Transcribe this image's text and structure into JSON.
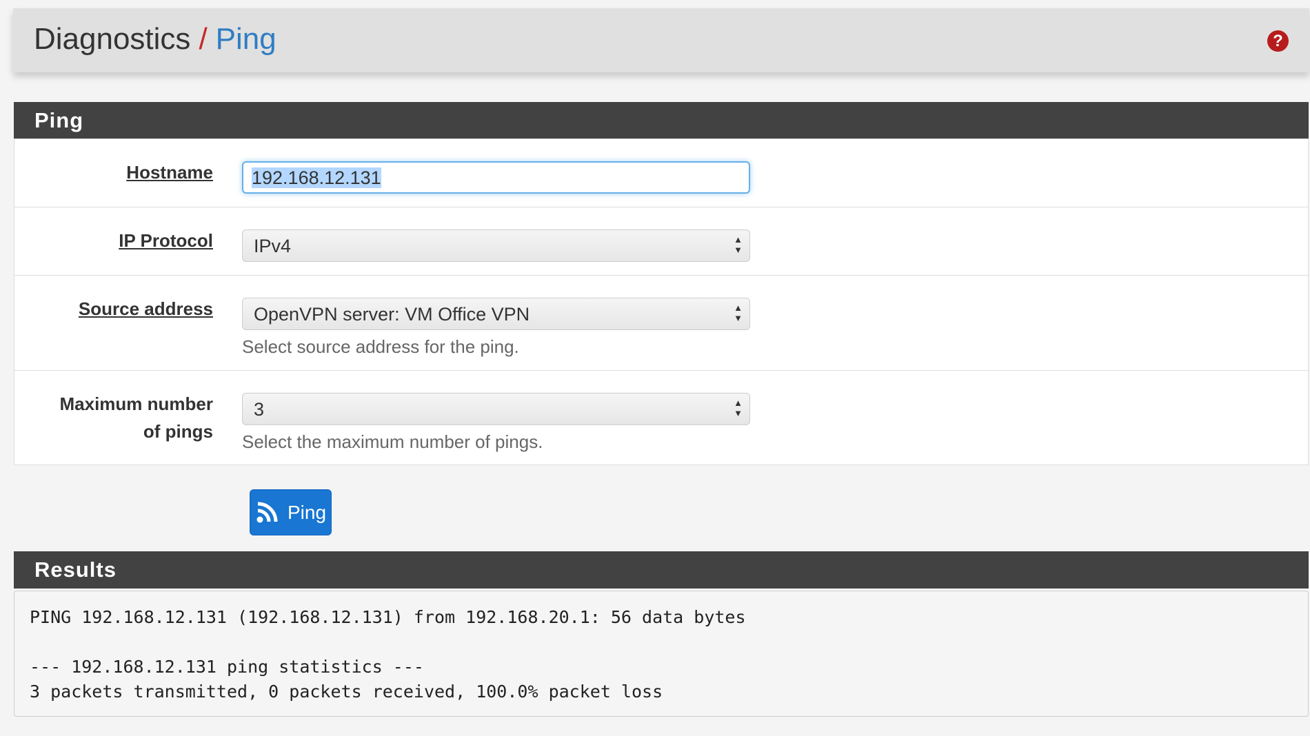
{
  "header": {
    "section": "Diagnostics",
    "separator": "/",
    "page": "Ping",
    "help_icon": "question-circle-icon"
  },
  "ping_panel": {
    "title": "Ping",
    "hostname": {
      "label": "Hostname",
      "value": "192.168.12.131"
    },
    "ip_protocol": {
      "label": "IP Protocol",
      "value": "IPv4"
    },
    "source_address": {
      "label": "Source address",
      "value": "OpenVPN server: VM Office VPN",
      "help": "Select source address for the ping."
    },
    "max_pings": {
      "label_line1": "Maximum number",
      "label_line2": "of pings",
      "value": "3",
      "help": "Select the maximum number of pings."
    }
  },
  "ping_button": {
    "label": "Ping",
    "icon": "rss-icon",
    "color": "#1976d2"
  },
  "results": {
    "title": "Results",
    "output": "PING 192.168.12.131 (192.168.12.131) from 192.168.20.1: 56 data bytes\n\n--- 192.168.12.131 ping statistics ---\n3 packets transmitted, 0 packets received, 100.0% packet loss"
  }
}
